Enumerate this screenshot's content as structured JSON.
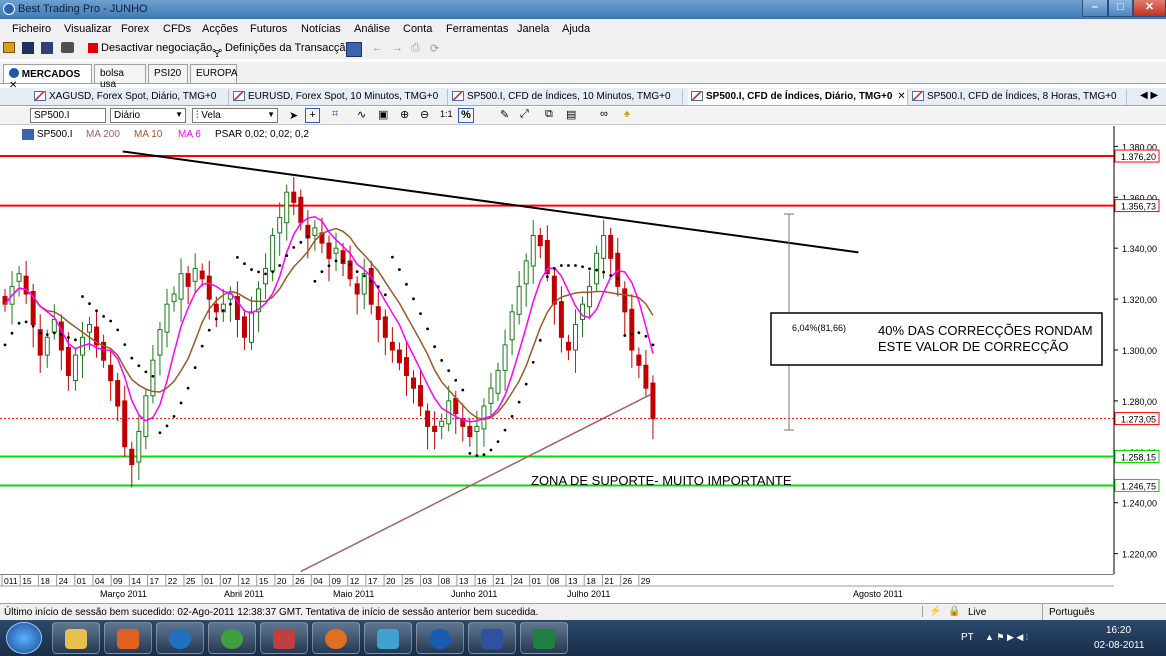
{
  "window": {
    "title": "Best Trading Pro - JUNHO"
  },
  "menu": [
    "Ficheiro",
    "Visualizar",
    "Forex",
    "CFDs",
    "Acções",
    "Futuros",
    "Notícias",
    "Análise",
    "Conta",
    "Ferramentas",
    "Janela",
    "Ajuda"
  ],
  "toolbar": {
    "deactivate_label": "Desactivar negociação",
    "settings_label": "Definições da Transacção"
  },
  "workspace_tabs": [
    {
      "label": "MERCADOS",
      "active": true
    },
    {
      "label": "bolsa usa",
      "active": false
    },
    {
      "label": "PSI20",
      "active": false
    },
    {
      "label": "EUROPA",
      "active": false
    }
  ],
  "chart_tabs": [
    {
      "label": "XAGUSD, Forex Spot, Diário, TMG+0",
      "active": false
    },
    {
      "label": "EURUSD, Forex Spot, 10 Minutos, TMG+0",
      "active": false
    },
    {
      "label": "SP500.I, CFD de Índices, 10 Minutos, TMG+0",
      "active": false
    },
    {
      "label": "SP500.I, CFD de Índices, Diário, TMG+0",
      "active": true
    },
    {
      "label": "SP500.I, CFD de Índices, 8 Horas, TMG+0",
      "active": false
    }
  ],
  "chart_toolbar": {
    "symbol": "SP500.I",
    "period": "Diário",
    "chart_type": "Vela"
  },
  "indicators": {
    "symbol": "SP500.I",
    "ma200": "MA 200",
    "ma10": "MA 10",
    "ma6": "MA 6",
    "psar": "PSAR 0,02; 0,02; 0,2"
  },
  "colors": {
    "resistance": "#ff0000",
    "support": "#00dd00",
    "trendline": "#000000",
    "ma200": "#a0606a",
    "ma10": "#9a5a2a",
    "ma6": "#ff00ff",
    "candle": "#1a7a1a",
    "candle_down": "#c00000",
    "price_line": "#d00000"
  },
  "chart_data": {
    "type": "candlestick",
    "symbol": "SP500.I",
    "period": "Diário",
    "ylim": [
      1212,
      1388
    ],
    "y_ticks": [
      "1.380,00",
      "1.360,00",
      "1.340,00",
      "1.320,00",
      "1.300,00",
      "1.280,00",
      "1.260,00",
      "1.240,00",
      "1.220,00"
    ],
    "y_tick_values": [
      1380,
      1360,
      1340,
      1320,
      1300,
      1280,
      1260,
      1240,
      1220
    ],
    "x_day_labels": [
      "011",
      "15",
      "18",
      "24",
      "01",
      "04",
      "09",
      "14",
      "17",
      "22",
      "25",
      "01",
      "07",
      "12",
      "15",
      "20",
      "26",
      "04",
      "09",
      "12",
      "17",
      "20",
      "25",
      "03",
      "08",
      "13",
      "16",
      "21",
      "24",
      "01",
      "08",
      "13",
      "18",
      "21",
      "26",
      "29"
    ],
    "x_month_labels": [
      "Março 2011",
      "Abril 2011",
      "Maio 2011",
      "Junho 2011",
      "Julho 2011",
      "Agosto 2011"
    ],
    "horizontal_levels": [
      {
        "price": 1376.2,
        "label": "1.376,20",
        "color": "#ff0000"
      },
      {
        "price": 1356.73,
        "label": "1.356,73",
        "color": "#ff0000"
      },
      {
        "price": 1273.05,
        "label": "1.273,05",
        "color": "#ff0000",
        "dotted": true
      },
      {
        "price": 1258.15,
        "label": "1.258,15",
        "color": "#00dd00"
      },
      {
        "price": 1246.75,
        "label": "1.246,75",
        "color": "#00dd00"
      }
    ],
    "closes": [
      1318,
      1325,
      1330,
      1322,
      1310,
      1298,
      1305,
      1312,
      1300,
      1290,
      1298,
      1305,
      1310,
      1302,
      1296,
      1288,
      1278,
      1262,
      1255,
      1268,
      1282,
      1296,
      1308,
      1318,
      1322,
      1330,
      1325,
      1332,
      1328,
      1320,
      1315,
      1318,
      1322,
      1312,
      1305,
      1315,
      1324,
      1332,
      1345,
      1352,
      1362,
      1358,
      1350,
      1344,
      1348,
      1342,
      1336,
      1340,
      1334,
      1328,
      1322,
      1330,
      1318,
      1312,
      1305,
      1300,
      1295,
      1290,
      1285,
      1278,
      1270,
      1268,
      1272,
      1280,
      1275,
      1270,
      1266,
      1270,
      1278,
      1285,
      1292,
      1302,
      1315,
      1325,
      1335,
      1345,
      1341,
      1330,
      1318,
      1305,
      1300,
      1310,
      1318,
      1325,
      1338,
      1345,
      1336,
      1325,
      1315,
      1300,
      1294,
      1285,
      1273
    ],
    "trendline": {
      "from": [
        17,
        1378
      ],
      "to": [
        103,
        1336
      ]
    },
    "annotations": [
      {
        "text": "40% DAS CORRECÇÕES RONDAM"
      },
      {
        "text": "ESTE VALOR DE CORRECÇÃO"
      },
      {
        "text": "6,04%(81,66)"
      },
      {
        "text": "ZONA DE SUPORTE- MUITO IMPORTANTE"
      }
    ]
  },
  "status": {
    "message": "Último início de sessão bem sucedido: 02-Ago-2011 12:38:37 GMT. Tentativa de início de sessão anterior bem sucedida.",
    "live_label": "Live",
    "language": "Português"
  },
  "taskbar": {
    "lang": "PT",
    "time": "16:20",
    "date": "02-08-2011"
  }
}
